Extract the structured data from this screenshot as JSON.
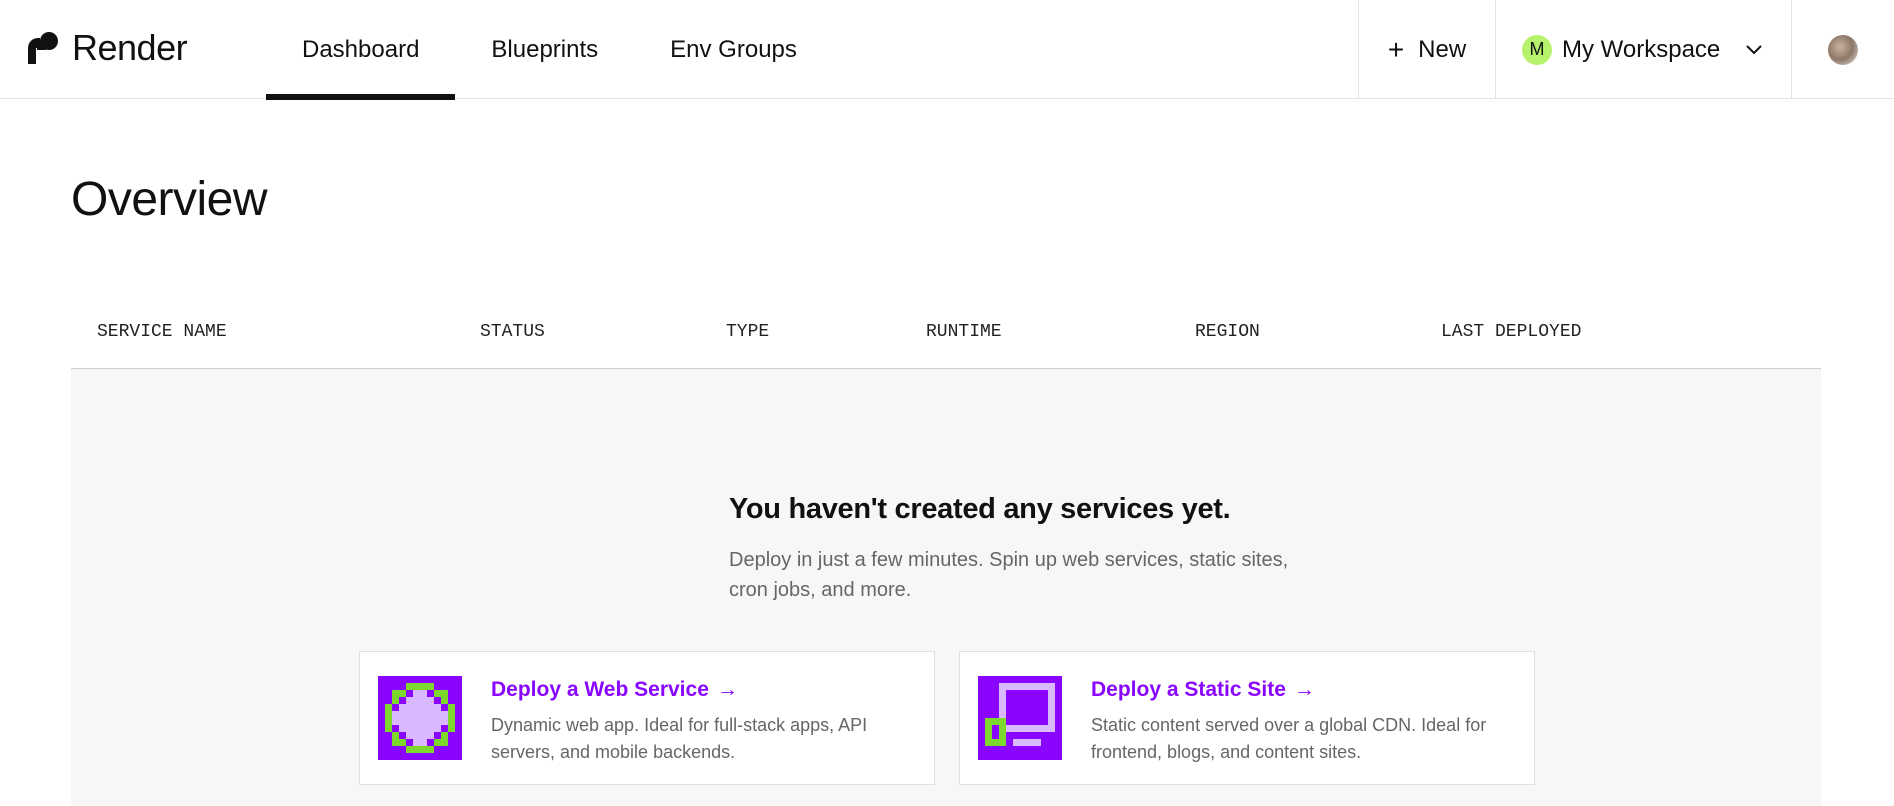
{
  "app": {
    "name": "Render"
  },
  "nav": {
    "tabs": [
      {
        "label": "Dashboard",
        "active": true
      },
      {
        "label": "Blueprints",
        "active": false
      },
      {
        "label": "Env Groups",
        "active": false
      }
    ]
  },
  "header": {
    "new_label": "New",
    "new_icon": "plus-icon",
    "workspace": {
      "initial": "M",
      "name": "My Workspace",
      "avatar_color": "#b6f26b"
    },
    "user_avatar_icon": "user-avatar"
  },
  "main": {
    "title": "Overview",
    "table": {
      "columns": [
        "SERVICE NAME",
        "STATUS",
        "TYPE",
        "RUNTIME",
        "REGION",
        "LAST DEPLOYED"
      ]
    },
    "empty_state": {
      "title": "You haven't created any services yet.",
      "description": "Deploy in just a few minutes. Spin up web services, static sites, cron jobs, and more.",
      "cards": [
        {
          "title": "Deploy a Web Service",
          "description": "Dynamic web app. Ideal for full-stack apps, API servers, and mobile backends.",
          "icon": "web-service-icon"
        },
        {
          "title": "Deploy a Static Site",
          "description": "Static content served over a global CDN. Ideal for frontend, blogs, and content sites.",
          "icon": "static-site-icon"
        }
      ]
    }
  },
  "colors": {
    "accent": "#8a05ff",
    "accent_green": "#7cd82c",
    "empty_bg": "#f7f7f7"
  }
}
